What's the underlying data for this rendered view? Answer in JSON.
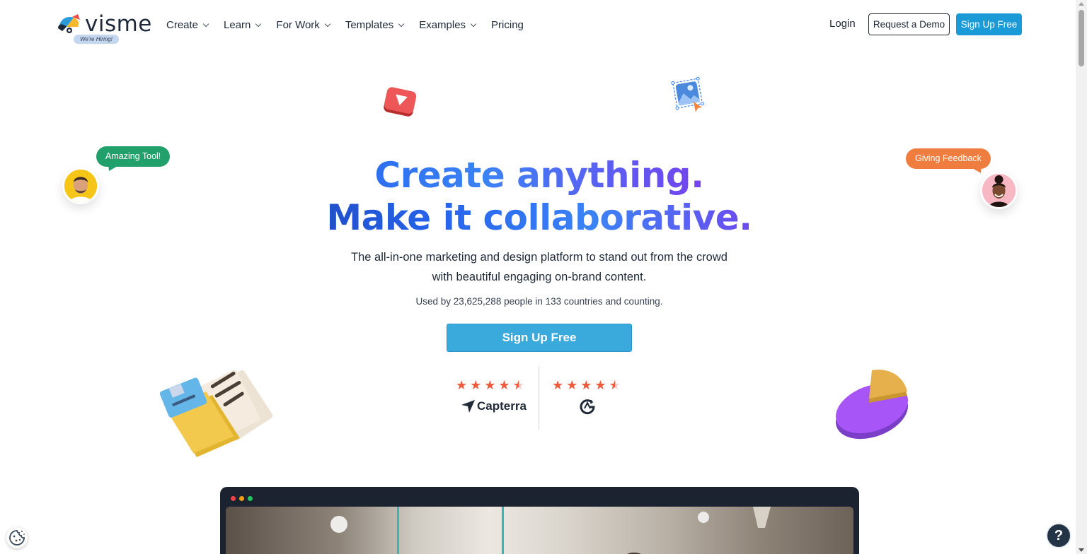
{
  "brand": {
    "logo_text": "visme",
    "hiring_badge": "We're Hiring!"
  },
  "nav": {
    "items": [
      {
        "label": "Create",
        "has_dropdown": true
      },
      {
        "label": "Learn",
        "has_dropdown": true
      },
      {
        "label": "For Work",
        "has_dropdown": true
      },
      {
        "label": "Templates",
        "has_dropdown": true
      },
      {
        "label": "Examples",
        "has_dropdown": true
      },
      {
        "label": "Pricing",
        "has_dropdown": false
      }
    ],
    "login": "Login",
    "demo": "Request a Demo",
    "signup": "Sign Up Free"
  },
  "hero": {
    "headline_line1_a": "Create",
    "headline_line1_b": "anything.",
    "headline_line2_a": "Make it",
    "headline_line2_b": "collaborative.",
    "subtitle_line1": "The all-in-one marketing and design platform to stand out from the crowd",
    "subtitle_line2": "with beautiful engaging on-brand content.",
    "usage": "Used by 23,625,288 people in 133 countries and counting.",
    "cta": "Sign Up Free"
  },
  "ratings": {
    "capterra": {
      "name": "Capterra",
      "stars": 4.5
    },
    "g2": {
      "name": "G2",
      "stars": 4.5
    }
  },
  "bubbles": {
    "left": "Amazing Tool!",
    "right": "Giving Feedback"
  },
  "help": {
    "label": "?"
  },
  "colors": {
    "accent": "#1a9ad6",
    "cta": "#3aa9db",
    "star": "#ef5a3c",
    "bubble_green": "#22a06b",
    "bubble_orange": "#ee7d3f",
    "preview_frame": "#1b2330"
  },
  "icons": {
    "cookie": "cookie-icon",
    "help": "help-icon",
    "play": "play-icon",
    "image": "image-icon"
  }
}
